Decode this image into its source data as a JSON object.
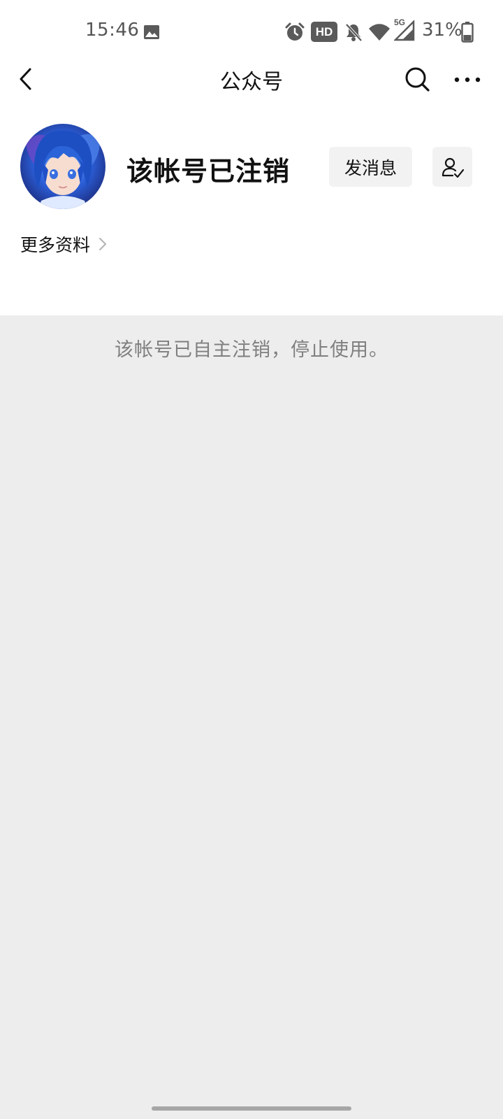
{
  "status_bar": {
    "time": "15:46",
    "battery_percent": "31%",
    "network_label": "5G",
    "hd_label": "HD",
    "icons": [
      "image-icon",
      "alarm-icon",
      "hd-icon",
      "mute-icon",
      "wifi-icon",
      "signal-icon",
      "battery-icon"
    ]
  },
  "nav": {
    "title": "公众号",
    "icons": [
      "back-icon",
      "search-icon",
      "more-icon"
    ]
  },
  "profile": {
    "account_name": "该帐号已注销",
    "send_message_label": "发消息",
    "more_info_label": "更多资料"
  },
  "content": {
    "notice": "该帐号已自主注销，停止使用。"
  }
}
